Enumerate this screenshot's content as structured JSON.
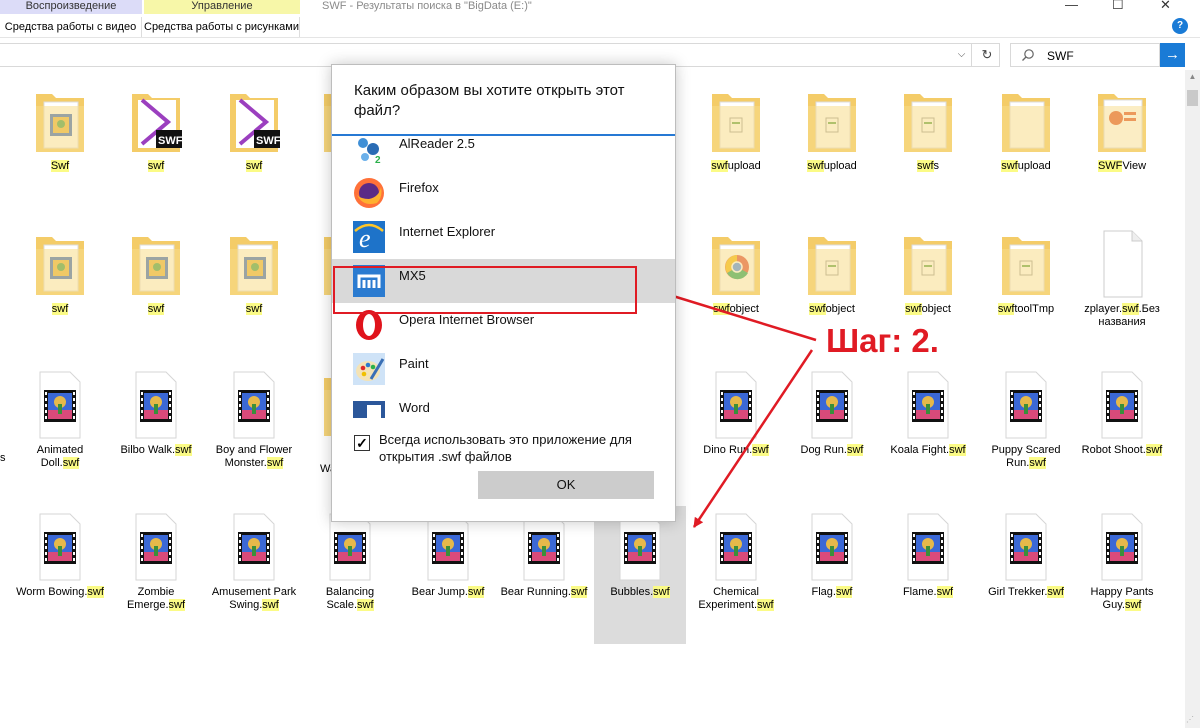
{
  "ribbon": {
    "tabs": [
      {
        "heading": "Воспроизведение",
        "label": "Средства работы с видео"
      },
      {
        "heading": "Управление",
        "label": "Средства работы с рисунками"
      }
    ],
    "window_title": "SWF - Результаты поиска в \"BigData (E:)\"",
    "window_controls": [
      "—",
      "☐",
      "✕"
    ],
    "help_glyph": "?"
  },
  "address": {
    "dropdown": "⌵",
    "refresh": "↻"
  },
  "search": {
    "value": "SWF",
    "go_glyph": "→"
  },
  "files": [
    {
      "pre": "",
      "hl": "Swf",
      "post": "",
      "icon": "folder-video"
    },
    {
      "pre": "",
      "hl": "swf",
      "post": "",
      "icon": "swf-file"
    },
    {
      "pre": "",
      "hl": "swf",
      "post": "",
      "icon": "swf-file"
    },
    {
      "pre": "",
      "hl": "swf",
      "post": "upload",
      "icon": "folder-doc"
    },
    {
      "pre": "",
      "hl": "swf",
      "post": "upload",
      "icon": "folder-doc"
    },
    {
      "pre": "",
      "hl": "swf",
      "post": "s",
      "icon": "folder-doc"
    },
    {
      "pre": "",
      "hl": "swf",
      "post": "upload",
      "icon": "folder-plain"
    },
    {
      "pre": "",
      "hl": "SWF",
      "post": "View",
      "icon": "folder-ppt"
    },
    {
      "pre": "",
      "hl": "swf",
      "post": "",
      "icon": "folder-video"
    },
    {
      "pre": "",
      "hl": "swf",
      "post": "",
      "icon": "folder-video"
    },
    {
      "pre": "",
      "hl": "swf",
      "post": "",
      "icon": "folder-video"
    },
    {
      "pre": "",
      "hl": "swf",
      "post": "object",
      "icon": "folder-chrome"
    },
    {
      "pre": "",
      "hl": "swf",
      "post": "object",
      "icon": "folder-doc"
    },
    {
      "pre": "",
      "hl": "swf",
      "post": "object",
      "icon": "folder-doc"
    },
    {
      "pre": "",
      "hl": "swf",
      "post": "toolTmp",
      "icon": "folder-doc"
    },
    {
      "pre": "zplayer.",
      "hl": "swf",
      "post": ".Без названия",
      "icon": "blank"
    },
    {
      "pre": "Animated Doll.",
      "hl": "swf",
      "post": "",
      "icon": "video"
    },
    {
      "pre": "Bilbo Walk.",
      "hl": "swf",
      "post": "",
      "icon": "video"
    },
    {
      "pre": "Boy and Flower Monster.",
      "hl": "swf",
      "post": "",
      "icon": "video"
    },
    {
      "pre": "Dino Run.",
      "hl": "swf",
      "post": "",
      "icon": "video"
    },
    {
      "pre": "Dog Run.",
      "hl": "swf",
      "post": "",
      "icon": "video"
    },
    {
      "pre": "Koala Fight.",
      "hl": "swf",
      "post": "",
      "icon": "video"
    },
    {
      "pre": "Puppy Scared Run.",
      "hl": "swf",
      "post": "",
      "icon": "video"
    },
    {
      "pre": "Robot Shoot.",
      "hl": "swf",
      "post": "",
      "icon": "video"
    },
    {
      "pre": "Worm Bowing.",
      "hl": "swf",
      "post": "",
      "icon": "video"
    },
    {
      "pre": "Zombie Emerge.",
      "hl": "swf",
      "post": "",
      "icon": "video"
    },
    {
      "pre": "Amusement Park Swing.",
      "hl": "swf",
      "post": "",
      "icon": "video"
    },
    {
      "pre": "Balancing Scale.",
      "hl": "swf",
      "post": "",
      "icon": "video"
    },
    {
      "pre": "Bear Jump.",
      "hl": "swf",
      "post": "",
      "icon": "video"
    },
    {
      "pre": "Bear Running.",
      "hl": "swf",
      "post": "",
      "icon": "video"
    },
    {
      "pre": "Bubbles.",
      "hl": "swf",
      "post": "",
      "icon": "video"
    },
    {
      "pre": "Chemical Experiment.",
      "hl": "swf",
      "post": "",
      "icon": "video"
    },
    {
      "pre": "Flag.",
      "hl": "swf",
      "post": "",
      "icon": "video"
    },
    {
      "pre": "Flame.",
      "hl": "swf",
      "post": "",
      "icon": "video"
    },
    {
      "pre": "Girl Trekker.",
      "hl": "swf",
      "post": "",
      "icon": "video"
    },
    {
      "pre": "Happy Pants Guy.",
      "hl": "swf",
      "post": "",
      "icon": "video"
    }
  ],
  "clipped_label_fragment": "Wa",
  "dialog": {
    "title": "Каким образом вы хотите открыть этот файл?",
    "apps": [
      {
        "name": "AlReader 2.5",
        "icon": "alreader-icon"
      },
      {
        "name": "Firefox",
        "icon": "firefox-icon"
      },
      {
        "name": "Internet Explorer",
        "icon": "internet-explorer-icon"
      },
      {
        "name": "MX5",
        "icon": "maxthon-icon"
      },
      {
        "name": "Opera Internet Browser",
        "icon": "opera-icon"
      },
      {
        "name": "Paint",
        "icon": "paint-icon"
      },
      {
        "name": "Word",
        "icon": "word-icon"
      }
    ],
    "selected_app": "MX5",
    "always_use_checked": true,
    "always_use_label": "Всегда использовать это приложение для открытия .swf файлов",
    "ok_label": "OK"
  },
  "annotation": {
    "step_text": "Шаг: 2.",
    "color": "#e01b24"
  },
  "colors": {
    "highlight": "#fbfb86",
    "accent": "#2679d4",
    "folder": "#f7d67a"
  }
}
